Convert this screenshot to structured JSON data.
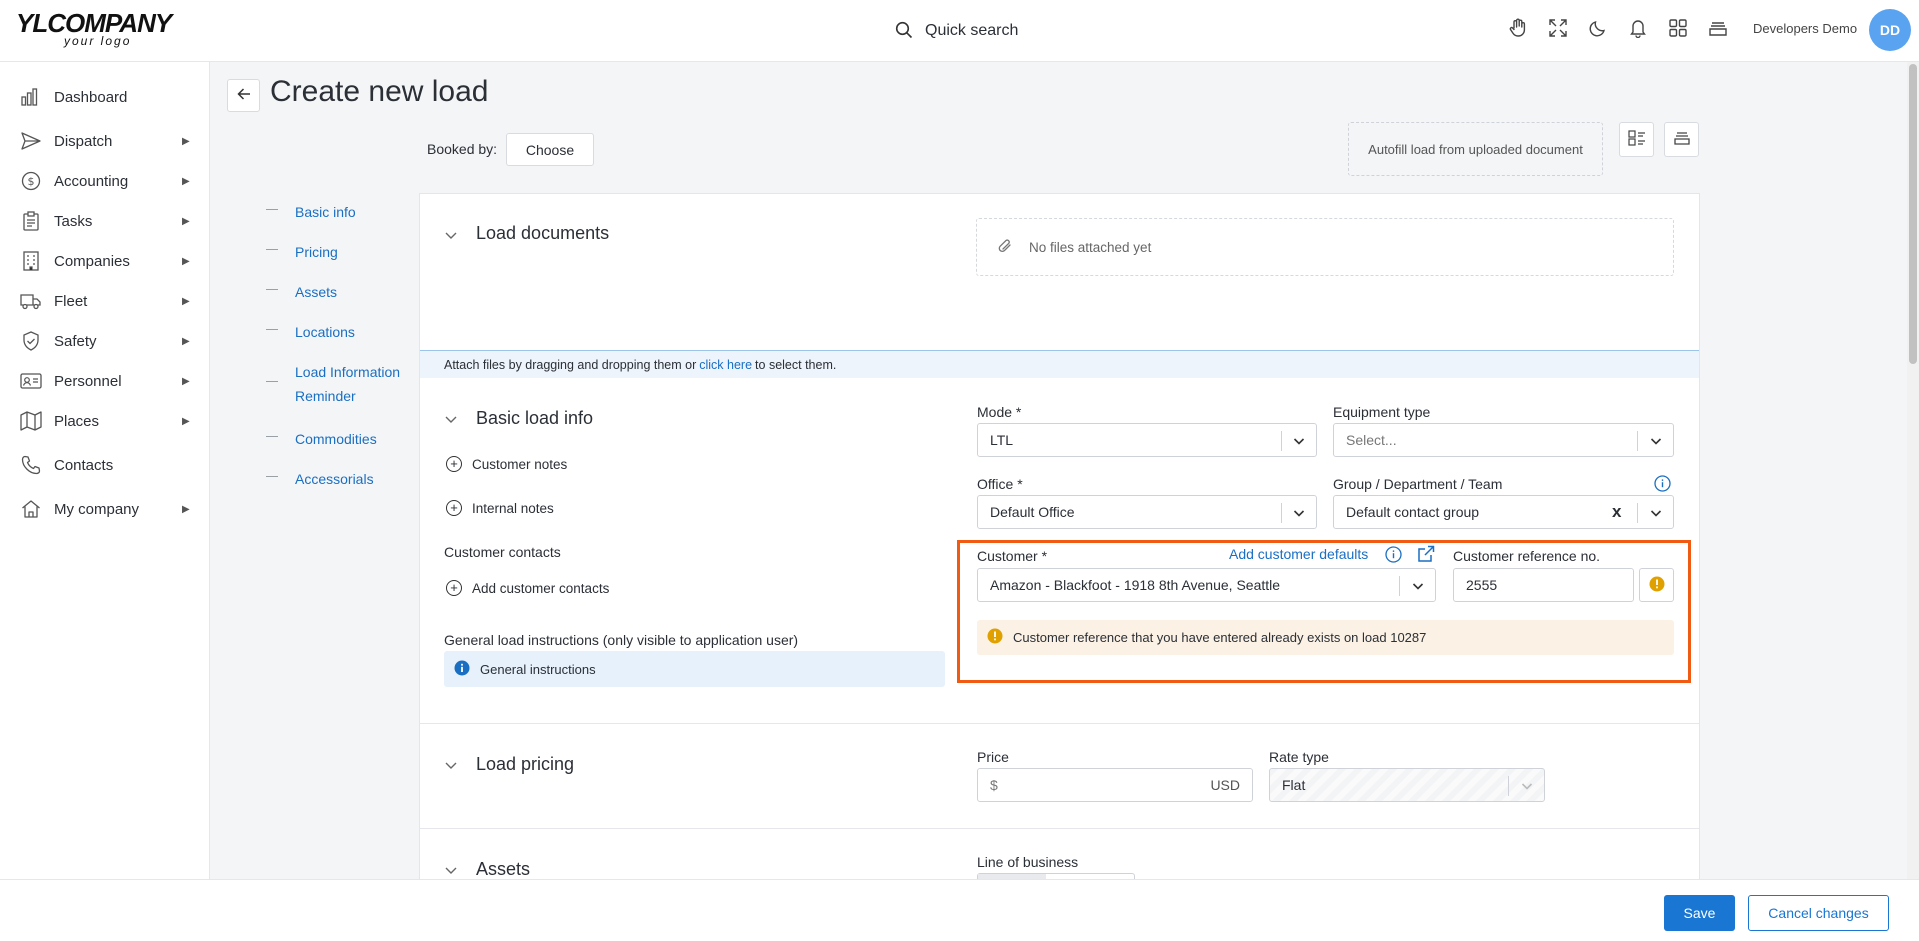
{
  "app": {
    "logo_text": "YLCOMPANY",
    "logo_tagline": "your logo",
    "search_label": "Quick search",
    "user_name": "Developers Demo",
    "user_initials": "DD"
  },
  "top_icons": [
    "hand-icon",
    "fullscreen-icon",
    "moon-icon",
    "bell-icon",
    "apps-grid-icon",
    "stack-icon"
  ],
  "sidebar": {
    "items": [
      {
        "label": "Dashboard",
        "icon": "chart-icon",
        "has_submenu": false
      },
      {
        "label": "Dispatch",
        "icon": "send-icon",
        "has_submenu": true
      },
      {
        "label": "Accounting",
        "icon": "dollar-icon",
        "has_submenu": true
      },
      {
        "label": "Tasks",
        "icon": "clipboard-icon",
        "has_submenu": true
      },
      {
        "label": "Companies",
        "icon": "building-icon",
        "has_submenu": true
      },
      {
        "label": "Fleet",
        "icon": "truck-icon",
        "has_submenu": true
      },
      {
        "label": "Safety",
        "icon": "shield-icon",
        "has_submenu": true
      },
      {
        "label": "Personnel",
        "icon": "id-card-icon",
        "has_submenu": true
      },
      {
        "label": "Places",
        "icon": "map-icon",
        "has_submenu": true
      },
      {
        "label": "Contacts",
        "icon": "phone-icon",
        "has_submenu": false
      },
      {
        "label": "My company",
        "icon": "home-icon",
        "has_submenu": true
      }
    ],
    "submenu_arrow": "▶"
  },
  "header": {
    "title": "Create new load",
    "booked_by_label": "Booked by:",
    "choose_label": "Choose",
    "autofill_label": "Autofill load from uploaded document"
  },
  "toc": [
    "Basic info",
    "Pricing",
    "Assets",
    "Locations",
    "Load Information Reminder",
    "Commodities",
    "Accessorials"
  ],
  "documents": {
    "title": "Load documents",
    "empty_text": "No files attached yet",
    "attach_prefix": "Attach files by dragging and dropping them or",
    "attach_link": "click here",
    "attach_suffix": "to select them."
  },
  "basic": {
    "title": "Basic load info",
    "customer_notes": "Customer notes",
    "internal_notes": "Internal notes",
    "customer_contacts_label": "Customer contacts",
    "add_customer_contacts": "Add customer contacts",
    "general_instructions_label": "General load instructions (only visible to application user)",
    "general_instructions_value": "General instructions",
    "mode_label": "Mode *",
    "mode_value": "LTL",
    "equipment_label": "Equipment type",
    "equipment_placeholder": "Select...",
    "office_label": "Office *",
    "office_value": "Default Office",
    "group_label": "Group / Department / Team",
    "group_value": "Default contact group",
    "customer_label": "Customer *",
    "add_customer_defaults": "Add customer defaults",
    "customer_value": "Amazon - Blackfoot - 1918 8th Avenue, Seattle",
    "customer_ref_label": "Customer reference no.",
    "customer_ref_value": "2555",
    "warning_text": "Customer reference that you have entered already exists on load 10287",
    "clear_symbol": "x"
  },
  "pricing": {
    "title": "Load pricing",
    "price_label": "Price",
    "price_prefix": "$",
    "price_currency": "USD",
    "rate_type_label": "Rate type",
    "rate_type_value": "Flat"
  },
  "assets": {
    "title": "Assets",
    "line_of_business_label": "Line of business"
  },
  "footer": {
    "save_label": "Save",
    "cancel_label": "Cancel changes"
  },
  "colors": {
    "accent": "#1976d2",
    "highlight": "#f05a12",
    "warning": "#e0a100",
    "info": "#1a6fc2"
  }
}
